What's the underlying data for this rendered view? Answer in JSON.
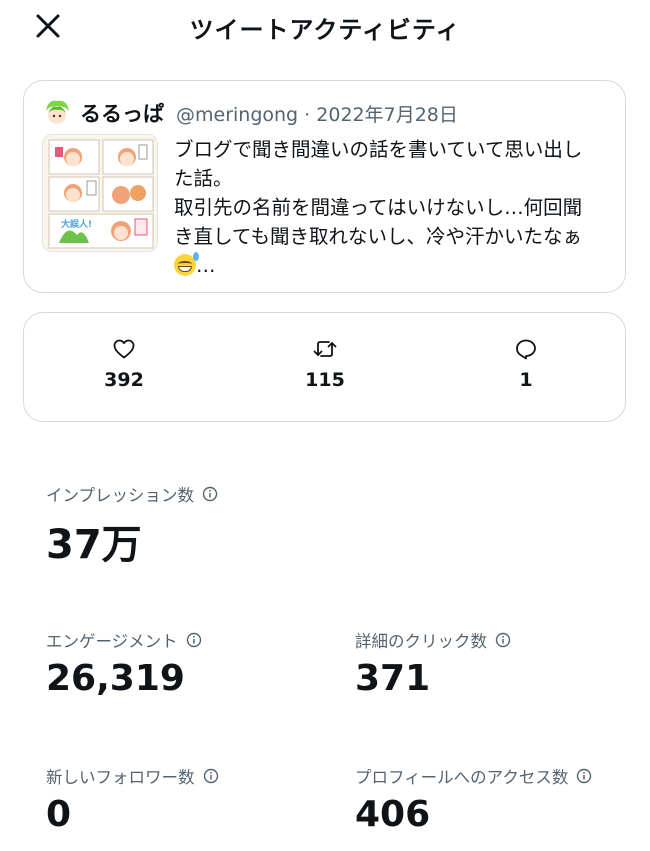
{
  "header": {
    "title": "ツイートアクティビティ"
  },
  "tweet": {
    "author_name": "るるっぱ",
    "handle": "@meringong",
    "date": "2022年7月28日",
    "text_lines": [
      "ブログで聞き間違いの話を書いていて思い出し",
      "た話。",
      "取引先の名前を間違ってはいけないし…何回聞",
      "き直しても聞き取れないし、冷や汗かいたなぁ"
    ],
    "text_tail": "…",
    "thumb_caption": "大誤人!"
  },
  "engagement": {
    "likes": "392",
    "retweets": "115",
    "replies": "1"
  },
  "metrics": {
    "impressions": {
      "label": "インプレッション数",
      "value": "37万"
    },
    "engagements": {
      "label": "エンゲージメント",
      "value": "26,319"
    },
    "detail_clicks": {
      "label": "詳細のクリック数",
      "value": "371"
    },
    "new_followers": {
      "label": "新しいフォロワー数",
      "value": "0"
    },
    "profile_visits": {
      "label": "プロフィールへのアクセス数",
      "value": "406"
    }
  },
  "colors": {
    "text": "#0f1419",
    "secondary": "#536471",
    "border": "#d5d9dd"
  },
  "icons": [
    "close-icon",
    "heart-icon",
    "retweet-icon",
    "reply-icon",
    "info-icon"
  ]
}
